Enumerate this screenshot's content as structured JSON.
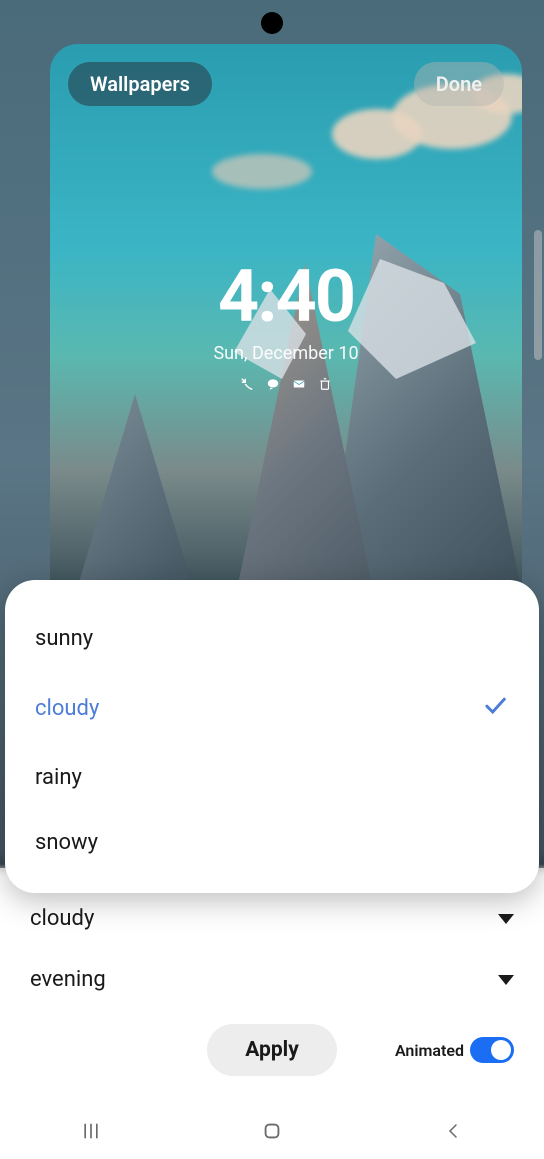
{
  "header": {
    "wallpapers_label": "Wallpapers",
    "done_label": "Done"
  },
  "lockscreen": {
    "time": "4:40",
    "date": "Sun, December 10",
    "notification_icons": [
      "missed-call-icon",
      "message-icon",
      "mail-icon",
      "trash-icon"
    ]
  },
  "weather_options": {
    "items": [
      {
        "label": "sunny",
        "selected": false
      },
      {
        "label": "cloudy",
        "selected": true
      },
      {
        "label": "rainy",
        "selected": false
      },
      {
        "label": "snowy",
        "selected": false
      }
    ]
  },
  "dropdowns": {
    "weather_selected": "cloudy",
    "time_of_day_selected": "evening"
  },
  "actions": {
    "apply_label": "Apply",
    "animated_label": "Animated",
    "animated_on": true
  }
}
